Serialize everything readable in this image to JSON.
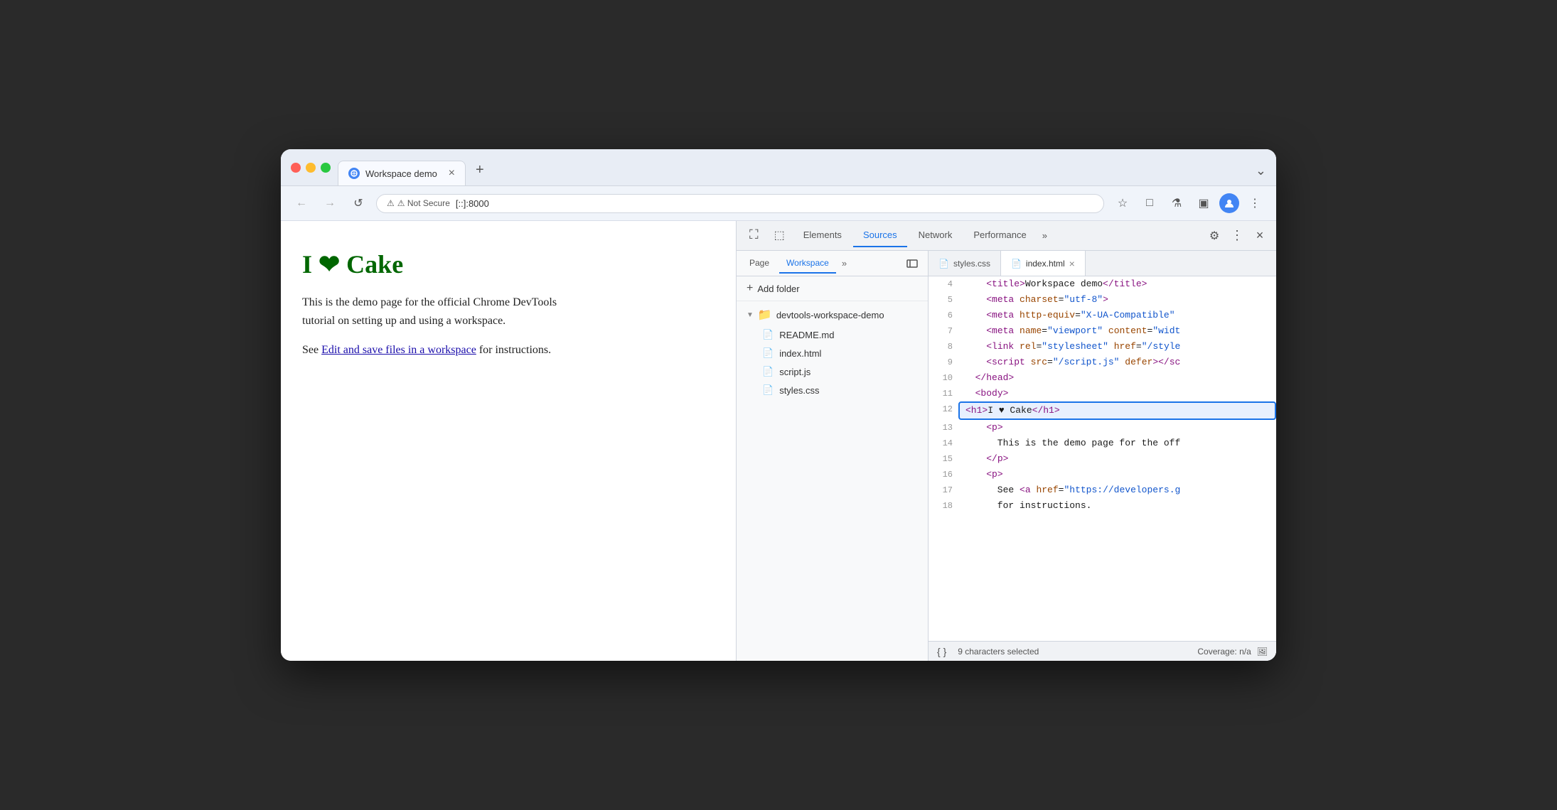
{
  "browser": {
    "tab": {
      "favicon": "globe",
      "title": "Workspace demo",
      "close_label": "×"
    },
    "new_tab_label": "+",
    "menu_label": "⌄",
    "nav": {
      "back_label": "←",
      "forward_label": "→",
      "reload_label": "↺",
      "security_label": "⚠ Not Secure",
      "url": "[::]:8000",
      "bookmark_label": "☆",
      "extensions_label": "□",
      "lab_label": "⚗",
      "sidebar_label": "▣",
      "avatar_label": "👤",
      "more_label": "⋮"
    }
  },
  "webpage": {
    "heading": "I ❤ Cake",
    "para1": "This is the demo page for the official Chrome DevTools tutorial on setting up and using a workspace.",
    "para2_prefix": "See ",
    "link_text": "Edit and save files in a workspace",
    "para2_suffix": " for instructions."
  },
  "devtools": {
    "tabs": [
      {
        "id": "inspect",
        "label": "⛶",
        "active": false
      },
      {
        "id": "device",
        "label": "⬚",
        "active": false
      },
      {
        "id": "elements",
        "label": "Elements",
        "active": false
      },
      {
        "id": "sources",
        "label": "Sources",
        "active": true
      },
      {
        "id": "network",
        "label": "Network",
        "active": false
      },
      {
        "id": "performance",
        "label": "Performance",
        "active": false
      },
      {
        "id": "more",
        "label": "»",
        "active": false
      }
    ],
    "gear_label": "⚙",
    "dots_label": "⋮",
    "close_label": "×",
    "sources": {
      "file_tree": {
        "tabs": [
          {
            "id": "page",
            "label": "Page",
            "active": false
          },
          {
            "id": "workspace",
            "label": "Workspace",
            "active": true
          }
        ],
        "more_label": "»",
        "add_folder": {
          "plus_label": "+",
          "label": "Add folder"
        },
        "folder": {
          "name": "devtools-workspace-demo",
          "files": [
            {
              "name": "README.md",
              "icon_type": "white"
            },
            {
              "name": "index.html",
              "icon_type": "white"
            },
            {
              "name": "script.js",
              "icon_type": "yellow"
            },
            {
              "name": "styles.css",
              "icon_type": "purple"
            }
          ]
        }
      },
      "editor": {
        "open_tabs": [
          {
            "id": "styles-css",
            "label": "styles.css",
            "active": false
          },
          {
            "id": "index-html",
            "label": "index.html",
            "active": true,
            "has_close": true
          }
        ],
        "lines": [
          {
            "num": 4,
            "raw": "    <title>Workspace demo</title>"
          },
          {
            "num": 5,
            "raw": "    <meta charset=\"utf-8\">"
          },
          {
            "num": 6,
            "raw": "    <meta http-equiv=\"X-UA-Compatible\""
          },
          {
            "num": 7,
            "raw": "    <meta name=\"viewport\" content=\"widt"
          },
          {
            "num": 8,
            "raw": "    <link rel=\"stylesheet\" href=\"/style"
          },
          {
            "num": 9,
            "raw": "    <script src=\"/script.js\" defer></sc"
          },
          {
            "num": 10,
            "raw": "  </head>"
          },
          {
            "num": 11,
            "raw": "  <body>"
          },
          {
            "num": 12,
            "raw": "    <h1>I ♥ Cake</h1>",
            "highlighted": true
          },
          {
            "num": 13,
            "raw": "    <p>"
          },
          {
            "num": 14,
            "raw": "      This is the demo page for the off"
          },
          {
            "num": 15,
            "raw": "    </p>"
          },
          {
            "num": 16,
            "raw": "    <p>"
          },
          {
            "num": 17,
            "raw": "      See <a href=\"https://developers.g"
          },
          {
            "num": 18,
            "raw": "      for instructions."
          }
        ]
      },
      "statusbar": {
        "curly_label": "{ }",
        "selected_chars": "9 characters selected",
        "coverage_label": "Coverage: n/a",
        "screenshot_label": "🖼"
      }
    }
  }
}
